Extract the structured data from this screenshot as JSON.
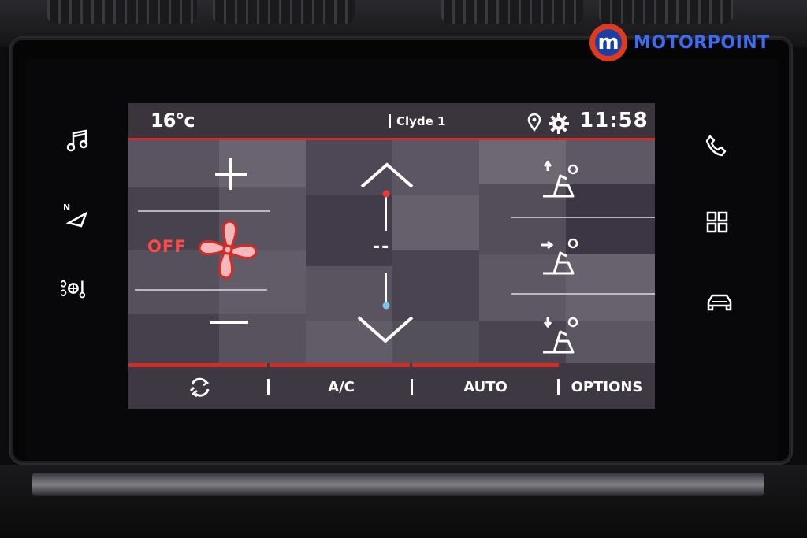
{
  "brand": {
    "logo_letter": "m",
    "logo_text": "MOTORPOINT"
  },
  "side_keys": {
    "left": [
      "music-icon",
      "navigation-icon",
      "climate-icon"
    ],
    "right": [
      "phone-icon",
      "apps-grid-icon",
      "car-icon"
    ]
  },
  "status_bar": {
    "outside_temp": "16°c",
    "profile": "Clyde 1",
    "time": "11:58",
    "icons": [
      "location-pin-icon",
      "settings-gear-icon"
    ]
  },
  "climate": {
    "fan_state": "OFF",
    "temperature_value": "--",
    "temperature_level": 0.5
  },
  "bottom_bar": {
    "recirculation_icon": "recirculation-icon",
    "ac_label": "A/C",
    "auto_label": "AUTO",
    "options_label": "OPTIONS"
  },
  "colors": {
    "accent_red": "#d52a25",
    "off_red": "#ff4a45",
    "brand_red": "#e03a1e",
    "brand_blue": "#1b3fa6",
    "brand_text_blue": "#3d6cf0"
  }
}
